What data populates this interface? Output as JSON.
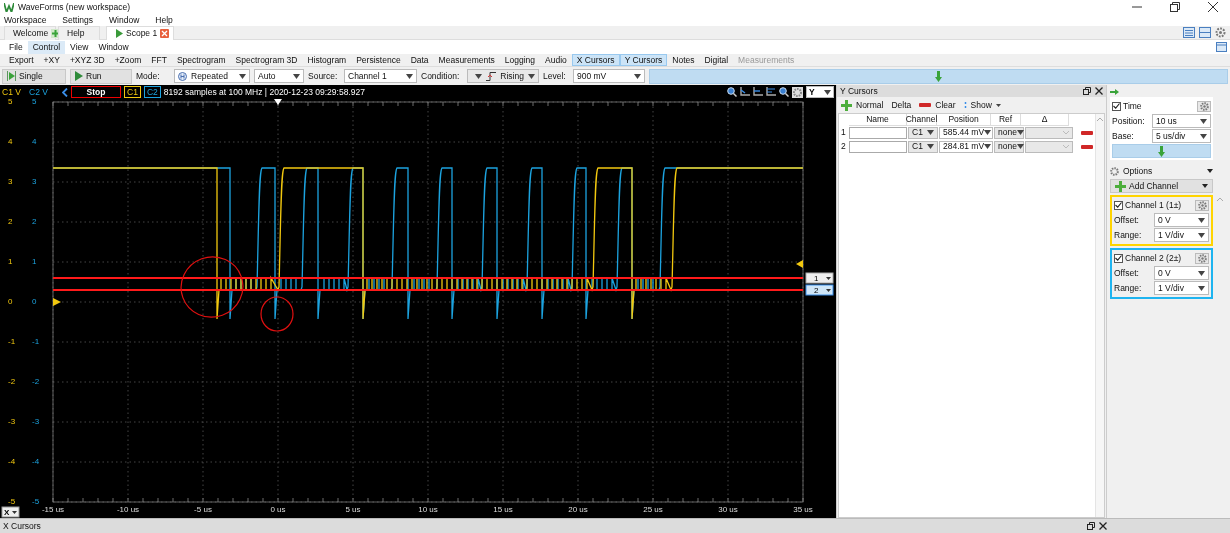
{
  "window": {
    "title": "WaveForms (new workspace)"
  },
  "menu": [
    "Workspace",
    "Settings",
    "Window",
    "Help"
  ],
  "tabs": [
    {
      "label": "Welcome",
      "kind": "add",
      "selected": false
    },
    {
      "label": "Help",
      "kind": "plain",
      "selected": false
    },
    {
      "label": "Scope 1",
      "kind": "scope",
      "selected": true
    }
  ],
  "submenu": [
    {
      "label": "File",
      "selected": false
    },
    {
      "label": "Control",
      "selected": true
    },
    {
      "label": "View",
      "selected": false
    },
    {
      "label": "Window",
      "selected": false
    }
  ],
  "toolbar": [
    {
      "label": "Export",
      "selected": false,
      "disabled": false
    },
    {
      "label": "+XY",
      "selected": false,
      "disabled": false
    },
    {
      "label": "+XYZ 3D",
      "selected": false,
      "disabled": false
    },
    {
      "label": "+Zoom",
      "selected": false,
      "disabled": false
    },
    {
      "label": "FFT",
      "selected": false,
      "disabled": false
    },
    {
      "label": "Spectrogram",
      "selected": false,
      "disabled": false
    },
    {
      "label": "Spectrogram 3D",
      "selected": false,
      "disabled": false
    },
    {
      "label": "Histogram",
      "selected": false,
      "disabled": false
    },
    {
      "label": "Persistence",
      "selected": false,
      "disabled": false
    },
    {
      "label": "Data",
      "selected": false,
      "disabled": false
    },
    {
      "label": "Measurements",
      "selected": false,
      "disabled": false
    },
    {
      "label": "Logging",
      "selected": false,
      "disabled": false
    },
    {
      "label": "Audio",
      "selected": false,
      "disabled": false
    },
    {
      "label": "X Cursors",
      "selected": true,
      "disabled": false
    },
    {
      "label": "Y Cursors",
      "selected": true,
      "disabled": false
    },
    {
      "label": "Notes",
      "selected": false,
      "disabled": false
    },
    {
      "label": "Digital",
      "selected": false,
      "disabled": false
    },
    {
      "label": "Measurements",
      "selected": false,
      "disabled": true
    }
  ],
  "control": {
    "single": "Single",
    "run": "Run",
    "mode_label": "Mode:",
    "mode": "Repeated",
    "mode_auto": "Auto",
    "source_label": "Source:",
    "source": "Channel 1",
    "condition_label": "Condition:",
    "condition": "Rising",
    "level_label": "Level:",
    "level_value": "900 mV"
  },
  "plot": {
    "axis_labels": [
      "C1 V",
      "C2 V"
    ],
    "stop": "Stop",
    "channels": [
      {
        "label": "C1",
        "color": "#f2c80f"
      },
      {
        "label": "C2",
        "color": "#1ca3df"
      }
    ],
    "info": "8192 samples at 100 MHz | 2020-12-23 09:29:58.927",
    "y_axis": "Y",
    "x_axis": "X",
    "c1_ticks": [
      "5",
      "4",
      "3",
      "2",
      "1",
      "0",
      "-1",
      "-2",
      "-3",
      "-4",
      "-5"
    ],
    "c2_ticks": [
      "5",
      "4",
      "3",
      "2",
      "1",
      "0",
      "-1",
      "-2",
      "-3",
      "-4",
      "-5"
    ],
    "x_ticks": [
      "-15 us",
      "-10 us",
      "-5 us",
      "0 us",
      "5 us",
      "10 us",
      "15 us",
      "20 us",
      "25 us",
      "30 us",
      "35 us"
    ],
    "cursor_markers": [
      {
        "label": "1",
        "selected": false
      },
      {
        "label": "2",
        "selected": true
      }
    ]
  },
  "y_cursors": {
    "title": "Y Cursors",
    "tools": [
      {
        "label": "Normal",
        "kind": "add"
      },
      {
        "label": "Delta",
        "kind": "plain"
      },
      {
        "label": "Clear",
        "kind": "remove"
      },
      {
        "label": "Show",
        "kind": "menu"
      }
    ],
    "columns": [
      "Name",
      "Channel",
      "Position",
      "Ref",
      "Δ"
    ],
    "rows": [
      {
        "index": "1",
        "channel": "C1",
        "position": "585.44 mV",
        "ref": "none"
      },
      {
        "index": "2",
        "channel": "C1",
        "position": "284.81 mV",
        "ref": "none"
      }
    ]
  },
  "side": {
    "time": {
      "label": "Time",
      "checked": true,
      "position_label": "Position:",
      "position": "10 us",
      "base_label": "Base:",
      "base": "5 us/div"
    },
    "options": "Options",
    "add_channel": "Add Channel",
    "channels": [
      {
        "label": "Channel 1 (1±)",
        "checked": true,
        "color": "#ffd400",
        "offset_label": "Offset:",
        "offset": "0 V",
        "range_label": "Range:",
        "range": "1 V/div"
      },
      {
        "label": "Channel 2 (2±)",
        "checked": true,
        "color": "#1eb4f0",
        "offset_label": "Offset:",
        "offset": "0 V",
        "range_label": "Range:",
        "range": "1 V/div"
      }
    ]
  },
  "bottom_dock": {
    "title": "X Cursors"
  }
}
